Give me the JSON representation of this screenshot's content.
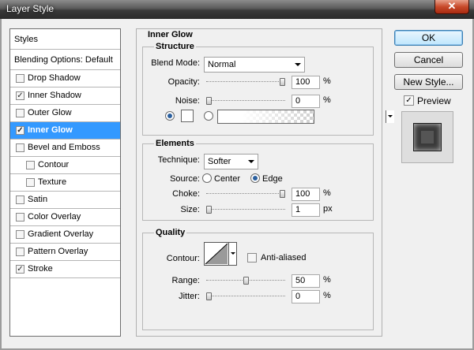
{
  "window": {
    "title": "Layer Style",
    "close_glyph": "✕"
  },
  "styles_list": {
    "header": "Styles",
    "blending": "Blending Options: Default",
    "items": [
      {
        "label": "Drop Shadow",
        "checked": false
      },
      {
        "label": "Inner Shadow",
        "checked": true
      },
      {
        "label": "Outer Glow",
        "checked": false
      },
      {
        "label": "Inner Glow",
        "checked": true,
        "selected": true
      },
      {
        "label": "Bevel and Emboss",
        "checked": false
      },
      {
        "label": "Contour",
        "checked": false,
        "indent": true
      },
      {
        "label": "Texture",
        "checked": false,
        "indent": true
      },
      {
        "label": "Satin",
        "checked": false
      },
      {
        "label": "Color Overlay",
        "checked": false
      },
      {
        "label": "Gradient Overlay",
        "checked": false
      },
      {
        "label": "Pattern Overlay",
        "checked": false
      },
      {
        "label": "Stroke",
        "checked": true
      }
    ]
  },
  "panel": {
    "title": "Inner Glow",
    "structure": {
      "title": "Structure",
      "blend_mode_label": "Blend Mode:",
      "blend_mode_value": "Normal",
      "opacity_label": "Opacity:",
      "opacity_value": "100",
      "opacity_level": 1.0,
      "noise_label": "Noise:",
      "noise_value": "0",
      "noise_level": 0.0,
      "unit": "%",
      "color_mode_selected": "solid"
    },
    "elements": {
      "title": "Elements",
      "technique_label": "Technique:",
      "technique_value": "Softer",
      "source_label": "Source:",
      "source_center": "Center",
      "source_edge": "Edge",
      "source_selected": "edge",
      "choke_label": "Choke:",
      "choke_value": "100",
      "choke_level": 1.0,
      "choke_unit": "%",
      "size_label": "Size:",
      "size_value": "1",
      "size_level": 0.0,
      "size_unit": "px"
    },
    "quality": {
      "title": "Quality",
      "contour_label": "Contour:",
      "antialiased_label": "Anti-aliased",
      "antialiased_checked": false,
      "range_label": "Range:",
      "range_value": "50",
      "range_level": 0.5,
      "range_unit": "%",
      "jitter_label": "Jitter:",
      "jitter_value": "0",
      "jitter_level": 0.0,
      "jitter_unit": "%"
    }
  },
  "buttons": {
    "ok": "OK",
    "cancel": "Cancel",
    "new_style": "New Style..."
  },
  "preview": {
    "label": "Preview",
    "checked": true
  },
  "colors": {
    "selection": "#3399ff",
    "glow_color": "#ffffff"
  }
}
